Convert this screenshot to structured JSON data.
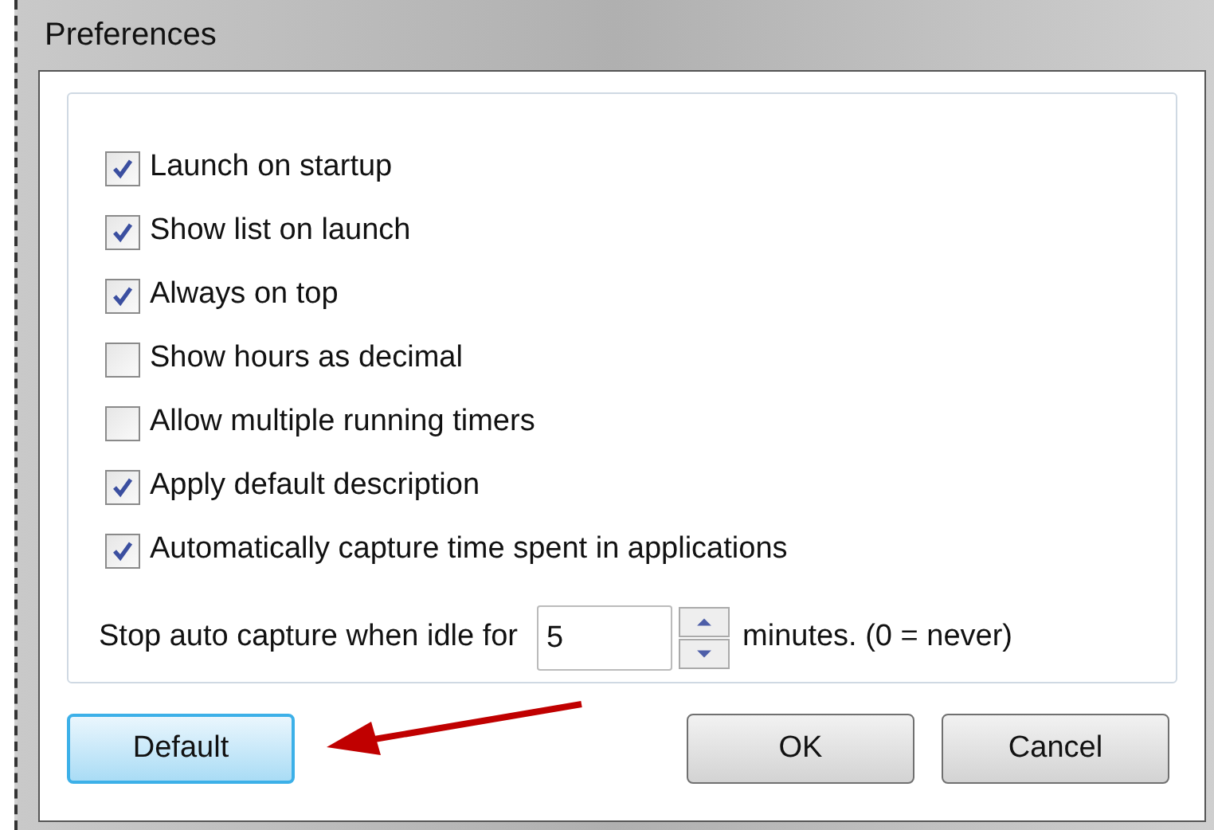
{
  "window": {
    "title": "Preferences"
  },
  "options": [
    {
      "label": "Launch on startup",
      "checked": true
    },
    {
      "label": "Show list on launch",
      "checked": true
    },
    {
      "label": "Always on top",
      "checked": true
    },
    {
      "label": "Show hours as decimal",
      "checked": false
    },
    {
      "label": "Allow multiple running timers",
      "checked": false
    },
    {
      "label": "Apply default description",
      "checked": true
    },
    {
      "label": "Automatically capture time spent in applications",
      "checked": true
    }
  ],
  "idle": {
    "label": "Stop auto capture when idle for",
    "value": "5",
    "suffix": "minutes. (0 = never)"
  },
  "buttons": [
    {
      "label": "Default",
      "focused": true
    },
    {
      "label": "OK",
      "focused": false
    },
    {
      "label": "Cancel",
      "focused": false
    }
  ]
}
